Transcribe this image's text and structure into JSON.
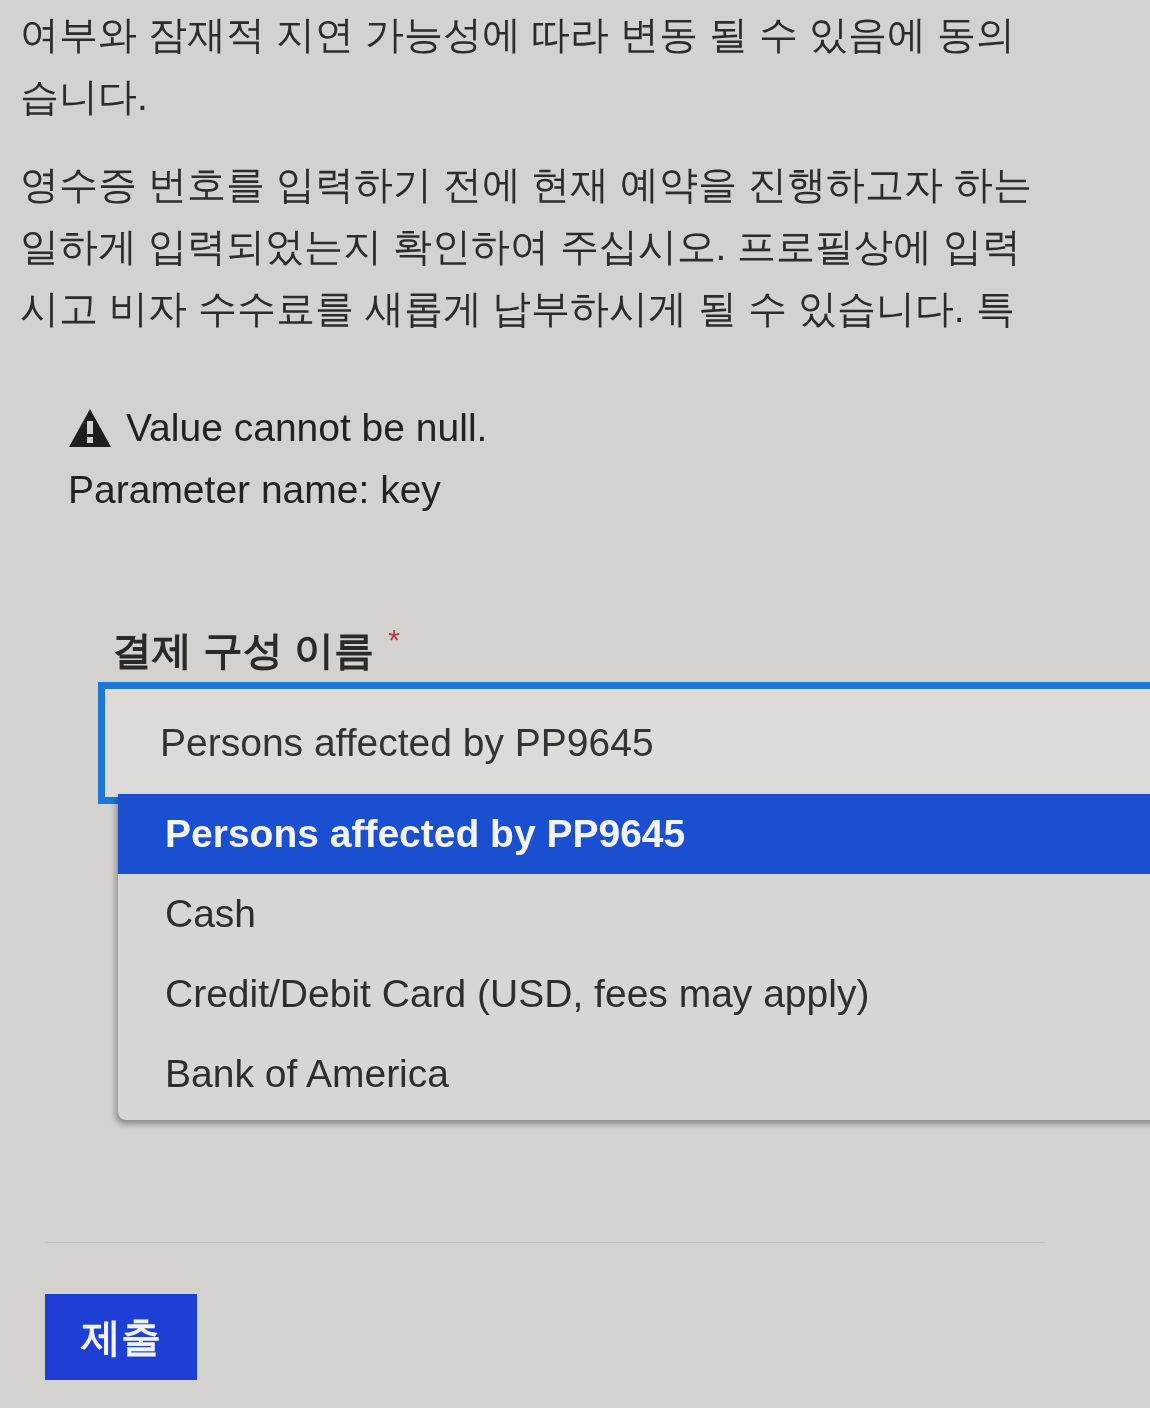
{
  "intro_paragraphs": [
    {
      "lines": [
        "여부와 잠재적 지연 가능성에 따라 변동 될 수 있음에 동의",
        "습니다."
      ]
    },
    {
      "lines": [
        "영수증 번호를 입력하기 전에 현재 예약을 진행하고자 하는",
        "일하게 입력되었는지 확인하여 주십시오. 프로필상에 입력",
        "시고 비자 수수료를 새롭게 납부하시게 될 수 있습니다. 특"
      ]
    }
  ],
  "error": {
    "message": "Value cannot be null.",
    "detail": "Parameter name: key"
  },
  "payment_field": {
    "label": "결제 구성 이름",
    "required_mark": "*",
    "value": "Persons affected by PP9645",
    "focused": true,
    "expanded": true,
    "options": [
      {
        "label": "Persons affected by PP9645",
        "selected": true
      },
      {
        "label": "Cash",
        "selected": false
      },
      {
        "label": "Credit/Debit Card (USD, fees may apply)",
        "selected": false
      },
      {
        "label": "Bank of America",
        "selected": false
      }
    ]
  },
  "submit_button": {
    "label": "제출"
  }
}
